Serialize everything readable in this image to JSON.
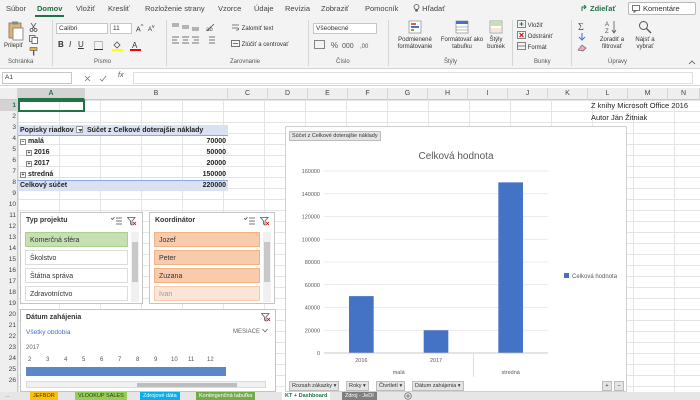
{
  "ribbon_tabs": [
    "Súbor",
    "Domov",
    "Vložiť",
    "Kresliť",
    "Rozloženie strany",
    "Vzorce",
    "Údaje",
    "Revízia",
    "Zobraziť",
    "Pomocník",
    "Hľadať"
  ],
  "share_label": "Zdieľať",
  "comments_label": "Komentáre",
  "ribbon": {
    "paste_label": "Prilepiť",
    "font_name": "Calibri",
    "font_size": "11",
    "wrap_text": "Zalomiť text",
    "merge_center": "Zlúčiť a centrovať",
    "number_format": "Všeobecné",
    "conditional_format": "Podmienené formátovanie",
    "format_as_table": "Formátovať ako tabuľku",
    "cell_styles": "Štýly buniek",
    "insert": "Vložiť",
    "delete": "Odstrániť",
    "format": "Formát",
    "sort_filter": "Zoradiť a filtrovať",
    "find_select": "Nájsť a vybrať",
    "groups": {
      "clipboard": "Schránka",
      "font": "Písmo",
      "alignment": "Zarovnanie",
      "number": "Číslo",
      "styles": "Štýly",
      "cells": "Bunky",
      "editing": "Úpravy"
    }
  },
  "name_box": "A1",
  "fx_label": "fx",
  "columns": [
    "A",
    "B",
    "C",
    "D",
    "E",
    "F",
    "G",
    "H",
    "I",
    "J",
    "K",
    "L",
    "M",
    "N"
  ],
  "rows": [
    "1",
    "2",
    "3",
    "4",
    "5",
    "6",
    "7",
    "8",
    "9",
    "10",
    "11",
    "12",
    "13",
    "14",
    "15",
    "16",
    "17",
    "18",
    "19",
    "20",
    "21",
    "22",
    "23",
    "24",
    "25",
    "26"
  ],
  "notes": {
    "line1": "Z knihy Microsoft Office 2016",
    "line2": "Autor Ján Žitniak"
  },
  "pivot": {
    "header_label": "Popisky riadkov",
    "header_value": "Súčet z Celkové doterajšie náklady",
    "rows": [
      {
        "label": "malá",
        "value": "70000"
      },
      {
        "label": "2016",
        "value": "50000"
      },
      {
        "label": "2017",
        "value": "20000"
      },
      {
        "label": "stredná",
        "value": "150000"
      },
      {
        "label": "Celkový súčet",
        "value": "220000"
      }
    ]
  },
  "slicer_type": {
    "title": "Typ projektu",
    "items": [
      "Komerčná sféra",
      "Školstvo",
      "Štátna správa",
      "Zdravotníctvo"
    ]
  },
  "slicer_coord": {
    "title": "Koordinátor",
    "items": [
      "Jozef",
      "Peter",
      "Zuzana",
      "Ivan"
    ]
  },
  "timeline": {
    "title": "Dátum zahájenia",
    "all_periods": "Všetky obdobia",
    "unit": "MESIACE",
    "year": "2017",
    "months": [
      "2",
      "3",
      "4",
      "5",
      "6",
      "7",
      "8",
      "9",
      "10",
      "11",
      "12"
    ]
  },
  "chart_data": {
    "type": "bar",
    "title": "Celková hodnota",
    "field_button": "Súčet z Celkové doterajšie náklady",
    "categories": [
      "2016",
      "2017",
      ""
    ],
    "groups": [
      "malá",
      "stredná"
    ],
    "series": [
      {
        "name": "Celková hodnota",
        "values": [
          50000,
          20000,
          150000
        ]
      }
    ],
    "yticks": [
      "0",
      "20000",
      "40000",
      "60000",
      "80000",
      "100000",
      "120000",
      "140000",
      "160000"
    ],
    "ylim": [
      0,
      160000
    ],
    "color": "#4472c4",
    "legend_position": "right",
    "filter_buttons": [
      "Rozsah zákazky",
      "Roky",
      "Čtvrtletí",
      "Dátum zahájenia"
    ]
  },
  "sheet_tabs": [
    "...",
    "JEFBOR",
    "VLOOKUP SALES",
    "Zdrojové dáta",
    "Kontingenčná tabuľka",
    "KT + Dashboard",
    "Zdroj - JeDI"
  ]
}
